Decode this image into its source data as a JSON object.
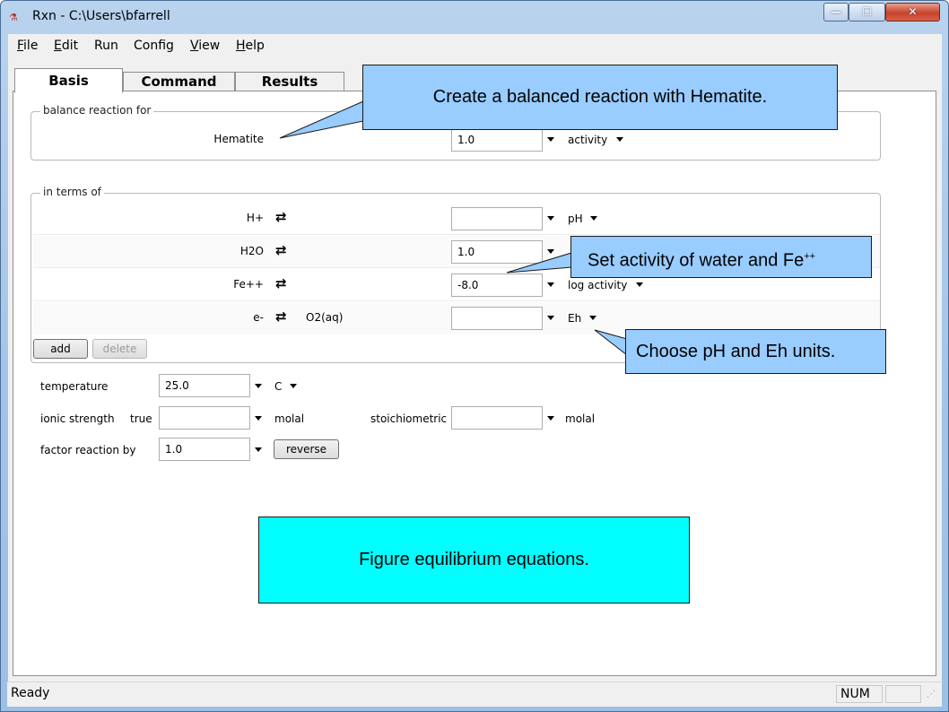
{
  "window": {
    "title": "Rxn - C:\\Users\\bfarrell",
    "minimize_glyph": "—",
    "maximize_glyph": "☐",
    "close_glyph": "✕"
  },
  "menu": [
    "File",
    "Edit",
    "Run",
    "Config",
    "View",
    "Help"
  ],
  "menu_underline": [
    "F",
    "E",
    "",
    "",
    "V",
    "H"
  ],
  "tabs": [
    "Basis",
    "Command",
    "Results"
  ],
  "balance": {
    "group_label": "balance reaction for",
    "species": "Hematite",
    "value": "1.0",
    "unit": "activity"
  },
  "terms": {
    "group_label": "in terms of",
    "rows": [
      {
        "species": "H+",
        "swap_with": "",
        "value": "",
        "unit": "pH"
      },
      {
        "species": "H2O",
        "swap_with": "",
        "value": "1.0",
        "unit": ""
      },
      {
        "species": "Fe++",
        "swap_with": "",
        "value": "-8.0",
        "unit": "log activity"
      },
      {
        "species": "e-",
        "swap_with": "O2(aq)",
        "value": "",
        "unit": "Eh"
      }
    ],
    "add_label": "add",
    "delete_label": "delete"
  },
  "conditions": {
    "temperature_label": "temperature",
    "temperature_value": "25.0",
    "temperature_unit": "C",
    "ionic_label": "ionic strength",
    "ionic_true_label": "true",
    "ionic_value": "",
    "ionic_unit": "molal",
    "stoich_label": "stoichiometric",
    "stoich_value": "",
    "stoich_unit": "molal",
    "factor_label": "factor reaction by",
    "factor_value": "1.0",
    "reverse_label": "reverse"
  },
  "callouts": {
    "hematite": "Create a balanced reaction with Hematite.",
    "water_fe": "Set activity of water and Fe",
    "water_fe_sup": "++",
    "units": "Choose pH and Eh units.",
    "equations": "Figure equilibrium equations."
  },
  "status": {
    "text": "Ready",
    "num": "NUM"
  },
  "colors": {
    "callout_blue": "#99ccff",
    "callout_cyan": "#00ffff"
  }
}
